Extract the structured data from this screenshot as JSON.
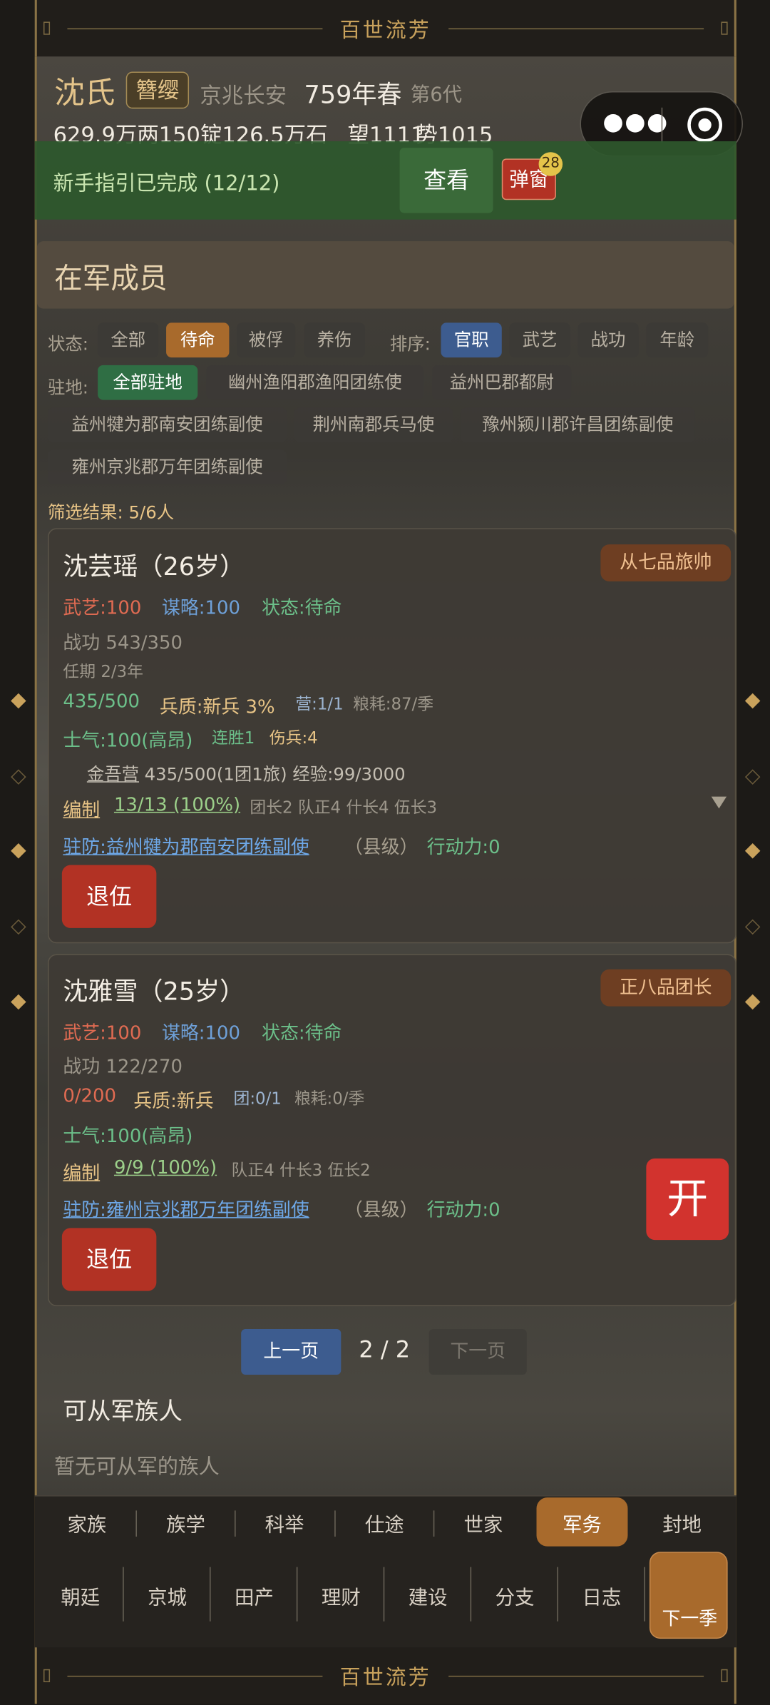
{
  "banner_text": "百世流芳",
  "header": {
    "family": "沈氏",
    "rank_badge": "簪缨",
    "location": "京兆长安",
    "year": "759年春",
    "generation": "第6代",
    "resources": "629.9万两150锭126.5万石",
    "prestige": "望1111",
    "power": "势1015"
  },
  "guide": {
    "text": "新手指引已完成 (12/12)",
    "view_label": "查看",
    "popup_label": "弹窗",
    "popup_badge": "28"
  },
  "section_title": "在军成员",
  "filters": {
    "status_label": "状态:",
    "status": [
      "全部",
      "待命",
      "被俘",
      "养伤"
    ],
    "status_active": "待命",
    "sort_label": "排序:",
    "sort": [
      "官职",
      "武艺",
      "战功",
      "年龄"
    ],
    "sort_active": "官职",
    "garrison_label": "驻地:",
    "garrisons": [
      "全部驻地",
      "幽州渔阳郡渔阳团练使",
      "益州巴郡都尉",
      "益州犍为郡南安团练副使",
      "荆州南郡兵马使",
      "豫州颍川郡许昌团练副使",
      "雍州京兆郡万年团练副使"
    ],
    "result": "筛选结果: 5/6人"
  },
  "members": [
    {
      "name": "沈芸瑶（26岁）",
      "rank": "从七品旅帅",
      "martial": "武艺:100",
      "strategy": "谋略:100",
      "status": "状态:待命",
      "merit": "战功 543/350",
      "term": "任期 2/3年",
      "troops": "435/500",
      "quality": "兵质:新兵 3%",
      "camp": "营:1/1",
      "grain": "粮耗:87/季",
      "morale": "士气:100(高昂)",
      "streak": "连胜1",
      "wounded": "伤兵:4",
      "unit_name": "金吾营",
      "unit_detail": "435/500(1团1旅) 经验:99/3000",
      "org_label": "编制",
      "org_value": "13/13 (100%)",
      "org_detail": "团长2 队正4 什长4 伍长3",
      "post": "驻防:益州犍为郡南安团练副使",
      "level": "（县级）",
      "action": "行动力:0",
      "retire": "退伍"
    },
    {
      "name": "沈雅雪（25岁）",
      "rank": "正八品团长",
      "martial": "武艺:100",
      "strategy": "谋略:100",
      "status": "状态:待命",
      "merit": "战功 122/270",
      "troops": "0/200",
      "quality": "兵质:新兵",
      "camp": "团:0/1",
      "grain": "粮耗:0/季",
      "morale": "士气:100(高昂)",
      "org_label": "编制",
      "org_value": "9/9 (100%)",
      "org_detail": "队正4 什长3 伍长2",
      "post": "驻防:雍州京兆郡万年团练副使",
      "level": "（县级）",
      "action": "行动力:0",
      "retire": "退伍"
    }
  ],
  "open_button": "开",
  "pager": {
    "prev": "上一页",
    "page": "2 / 2",
    "next": "下一页"
  },
  "eligible": {
    "title": "可从军族人",
    "empty": "暂无可从军的族人"
  },
  "tabs1": [
    "家族",
    "族学",
    "科举",
    "仕途",
    "世家",
    "军务",
    "封地"
  ],
  "tab_active": "军务",
  "tabs2": [
    "朝廷",
    "京城",
    "田产",
    "理财",
    "建设",
    "分支",
    "日志"
  ],
  "next_season": "下一季",
  "colors": {
    "accent_gold": "#c9a25c",
    "active_orange": "#a86a2c",
    "active_blue": "#3d5c8f",
    "active_green": "#2f6e44",
    "red": "#b23224",
    "guide_green": "#2f5a2e"
  }
}
